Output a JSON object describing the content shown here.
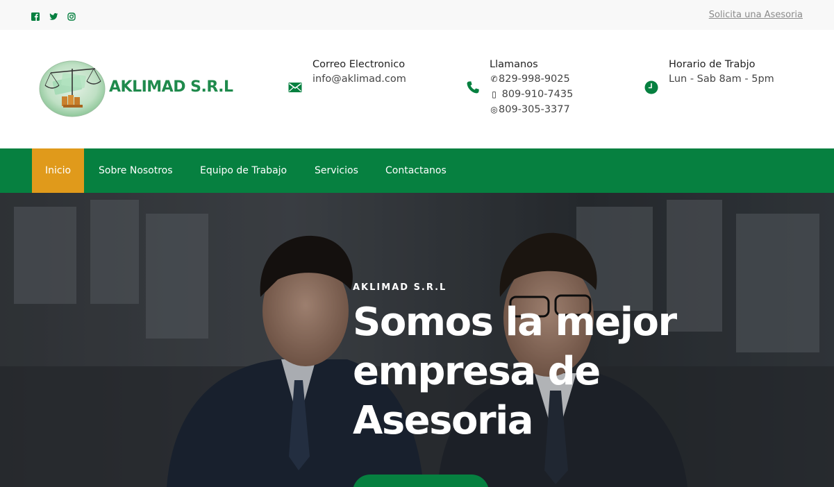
{
  "topbar": {
    "social": [
      "facebook-icon",
      "twitter-icon",
      "instagram-icon"
    ],
    "cta_link": "Solicita una Asesoria"
  },
  "header": {
    "logo_text": "AKLIMAD S.R.L",
    "email": {
      "title": "Correo Electronico",
      "value": "info@aklimad.com"
    },
    "phone": {
      "title": "Llamanos",
      "numbers": [
        "829-998-9025",
        "809-910-7435",
        "809-305-3377"
      ]
    },
    "hours": {
      "title": "Horario de Trabjo",
      "value": "Lun - Sab 8am - 5pm"
    }
  },
  "nav": {
    "items": [
      "Inicio",
      "Sobre Nosotros",
      "Equipo de Trabajo",
      "Servicios",
      "Contactanos"
    ]
  },
  "hero": {
    "subtitle": "AKLIMAD S.R.L",
    "title": "Somos la mejor empresa de Asesoria"
  },
  "colors": {
    "brand_green": "#068040",
    "accent_orange": "#e09a1b",
    "logo_green": "#1f8a4c"
  }
}
